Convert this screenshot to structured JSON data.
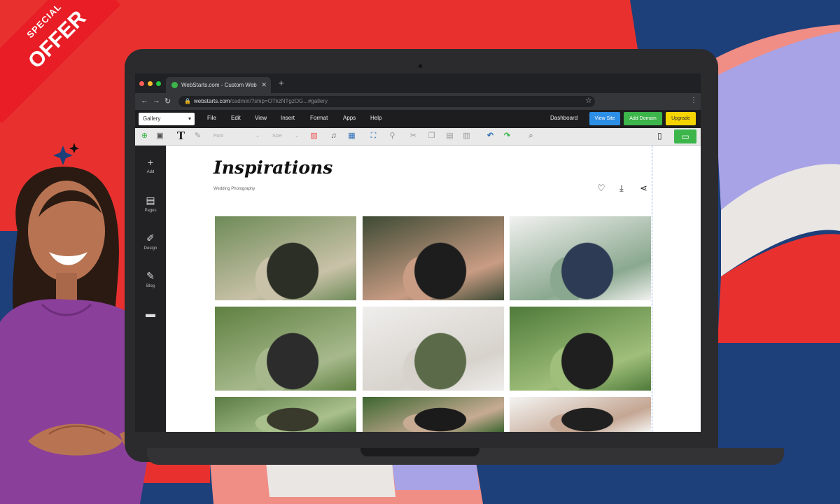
{
  "promo": {
    "ribbon_line1": "SPECIAL",
    "ribbon_line2": "OFFER",
    "colors": {
      "red": "#e8312f",
      "navy": "#1d3f7a",
      "lavender": "#a8a3e6",
      "salmon": "#f08d85"
    }
  },
  "browser": {
    "tab_title": "WebStarts.com - Custom Web",
    "tab_close": "✕",
    "new_tab": "+",
    "url_host": "webstarts.com",
    "url_path": "/cadmin/?ship=OTkzNTgzOG...#gallery",
    "back_icon": "←",
    "forward_icon": "→",
    "reload_icon": "↻"
  },
  "editor": {
    "page_select": "Gallery",
    "menu": [
      "File",
      "Edit",
      "View",
      "Insert",
      "Format",
      "Apps",
      "Help"
    ],
    "dashboard": "Dashboard",
    "view_site": "View Site",
    "add_domain": "Add Domain",
    "upgrade": "Upgrade",
    "font_select": "Font",
    "size_select": "Size",
    "sidebar": [
      {
        "label": "Add",
        "icon": "plus-icon"
      },
      {
        "label": "Pages",
        "icon": "page-icon"
      },
      {
        "label": "Design",
        "icon": "brush-icon"
      },
      {
        "label": "Blog",
        "icon": "pencil-icon"
      }
    ]
  },
  "page": {
    "title": "Inspirations",
    "subtitle": "Wedding Photography",
    "icons": [
      "heart-icon",
      "download-icon",
      "share-icon"
    ]
  },
  "gallery": [
    {
      "label": "couple-embracing-forest",
      "colors": [
        "#6e8b58",
        "#c9c2a8",
        "#2b2f26"
      ]
    },
    {
      "label": "couple-kissing-closeup",
      "colors": [
        "#3d4a34",
        "#c99c84",
        "#1d1d1d"
      ]
    },
    {
      "label": "bridal-bouquet",
      "colors": [
        "#f1f1ef",
        "#8aa88f",
        "#2d3b55"
      ]
    },
    {
      "label": "couple-walking-under-trees",
      "colors": [
        "#5f8041",
        "#a7b98c",
        "#2c2c2c"
      ]
    },
    {
      "label": "bride-with-bouquet",
      "colors": [
        "#efeeec",
        "#d7d2cc",
        "#5b6b4a"
      ]
    },
    {
      "label": "couple-holding-hands-path",
      "colors": [
        "#4f7a3a",
        "#9fbf7a",
        "#1f1f1f"
      ]
    },
    {
      "label": "trees-canopy",
      "colors": [
        "#5b7d44",
        "#a9c08d",
        "#3a3a2c"
      ]
    },
    {
      "label": "groom-and-bride-kissing",
      "colors": [
        "#3c6630",
        "#c7ab93",
        "#1b1b1b"
      ]
    },
    {
      "label": "couple-portrait",
      "colors": [
        "#f4f4f2",
        "#c4a693",
        "#202020"
      ]
    }
  ]
}
